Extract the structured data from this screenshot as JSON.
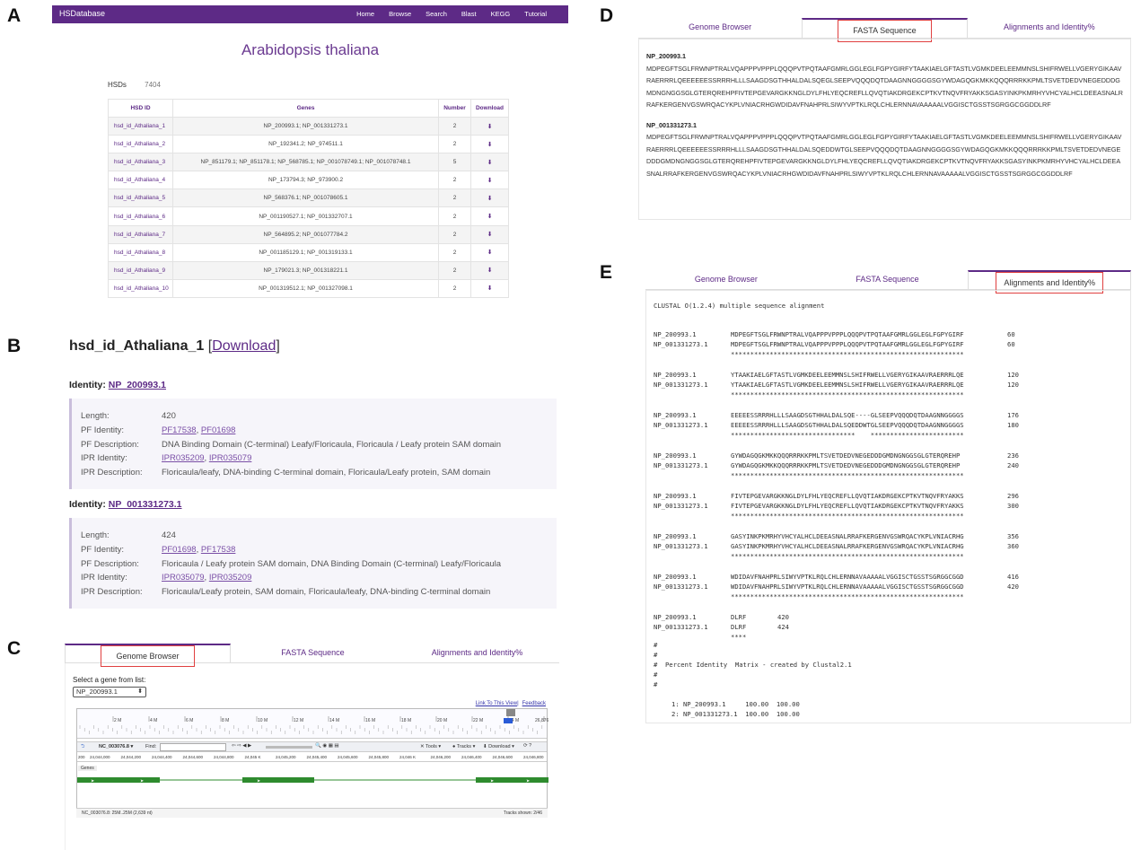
{
  "panel_labels": [
    "A",
    "B",
    "C",
    "D",
    "E"
  ],
  "panelA": {
    "brand": "HSDatabase",
    "nav": [
      "Home",
      "Browse",
      "Search",
      "Blast",
      "KEGG",
      "Tutorial"
    ],
    "species": "Arabidopsis thaliana",
    "hsds_label": "HSDs",
    "hsds_count": "7404",
    "columns": [
      "HSD ID",
      "Genes",
      "Number",
      "Download"
    ],
    "rows": [
      {
        "id": "hsd_id_Athaliana_1",
        "genes": "NP_200993.1; NP_001331273.1",
        "number": "2"
      },
      {
        "id": "hsd_id_Athaliana_2",
        "genes": "NP_192341.2; NP_974511.1",
        "number": "2"
      },
      {
        "id": "hsd_id_Athaliana_3",
        "genes": "NP_851179.1; NP_851178.1; NP_568785.1; NP_001078749.1; NP_001078748.1",
        "number": "5"
      },
      {
        "id": "hsd_id_Athaliana_4",
        "genes": "NP_173794.3; NP_973900.2",
        "number": "2"
      },
      {
        "id": "hsd_id_Athaliana_5",
        "genes": "NP_568376.1; NP_001078605.1",
        "number": "2"
      },
      {
        "id": "hsd_id_Athaliana_6",
        "genes": "NP_001190527.1; NP_001332707.1",
        "number": "2"
      },
      {
        "id": "hsd_id_Athaliana_7",
        "genes": "NP_564895.2; NP_001077784.2",
        "number": "2"
      },
      {
        "id": "hsd_id_Athaliana_8",
        "genes": "NP_001185129.1; NP_001319133.1",
        "number": "2"
      },
      {
        "id": "hsd_id_Athaliana_9",
        "genes": "NP_179021.3; NP_001318221.1",
        "number": "2"
      },
      {
        "id": "hsd_id_Athaliana_10",
        "genes": "NP_001319512.1; NP_001327098.1",
        "number": "2"
      }
    ]
  },
  "panelB": {
    "title": "hsd_id_Athaliana_1",
    "download": "Download",
    "identity_label": "Identity:",
    "entries": [
      {
        "identity": "NP_200993.1",
        "length": "420",
        "pf_identity": [
          "PF17538",
          "PF01698"
        ],
        "pf_description": "DNA Binding Domain (C-terminal) Leafy/Floricaula, Floricaula / Leafy protein SAM domain",
        "ipr_identity": [
          "IPR035209",
          "IPR035079"
        ],
        "ipr_description": "Floricaula/leafy, DNA-binding C-terminal domain, Floricaula/Leafy protein, SAM domain"
      },
      {
        "identity": "NP_001331273.1",
        "length": "424",
        "pf_identity": [
          "PF01698",
          "PF17538"
        ],
        "pf_description": "Floricaula / Leafy protein SAM domain, DNA Binding Domain (C-terminal) Leafy/Floricaula",
        "ipr_identity": [
          "IPR035079",
          "IPR035209"
        ],
        "ipr_description": "Floricaula/Leafy protein, SAM domain, Floricaula/leafy, DNA-binding C-terminal domain"
      }
    ],
    "keys": [
      "Length:",
      "PF Identity:",
      "PF Description:",
      "IPR Identity:",
      "IPR Description:"
    ]
  },
  "tabs": [
    "Genome Browser",
    "FASTA Sequence",
    "Alignments and Identity%"
  ],
  "panelC": {
    "select_label": "Select a gene from list:",
    "selected_gene": "NP_200993.1",
    "links": [
      "Link To This View",
      "Feedback"
    ],
    "ruler_ticks": [
      "2 M",
      "4 M",
      "6 M",
      "8 M",
      "10 M",
      "12 M",
      "14 M",
      "16 M",
      "18 M",
      "20 M",
      "22 M",
      "24 M",
      "26,876,602"
    ],
    "toolbar_chrom": "NC_003076.8",
    "toolbar_find": "Find:",
    "toolbar_tools": "Tools",
    "toolbar_tracks": "Tracks",
    "toolbar_download": "Download",
    "coords": [
      "24,044,000",
      "24,044,200",
      "24,044,400",
      "24,044,600",
      "24,044,800",
      "24,045 K",
      "24,045,200",
      "24,045,400",
      "24,045,600",
      "24,045,800",
      "24,046 K",
      "24,046,200",
      "24,046,400",
      "24,046,600",
      "24,046,800"
    ],
    "coords_right": "200",
    "track_name": "Genes",
    "status_left": "NC_003076.8: 25M..25M (2,639 nt)",
    "status_right": "Tracks shown: 2/46"
  },
  "panelD": {
    "entries": [
      {
        "name": "NP_200993.1",
        "seq": "MDPEGFTSGLFRWNPTRALVQAPPPVPPPLQQQPVTPQTAAFGMRLGGLEGLFGPYGIRFYTAAKIAELGFTASTLVGMKDEELEEMMNSLSHIFRWELLVGERYGIKAAVRAERRRLQEEEEEESSRRRHLLLSAAGDSGTHHALDALSQEGLSEEPVQQQDQTDAAGNNGGGGSGYWDAGQGKMKKQQQRRRKKPMLTSVETDEDVNEGEDDDGMDNGNGGSGLGTERQREHPFIVTEPGEVARGKKNGLDYLFHLYEQCREFLLQVQTIAKDRGEKCPTKVTNQVFRYAKKSGASYINKPKMRHYVHCYALHCLDEEASNALRRAFKERGENVGSWRQACYKPLVNIACRHGWDIDAVFNAHPRLSIWYVPTKLRQLCHLERNNAVAAAAALVGGISCTGSSTSGRGGCGGDDLRF"
      },
      {
        "name": "NP_001331273.1",
        "seq": "MDPEGFTSGLFRWNPTRALVQAPPPVPPPLQQQPVTPQTAAFGMRLGGLEGLFGPYGIRFYTAAKIAELGFTASTLVGMKDEELEEMMNSLSHIFRWELLVGERYGIKAAVRAERRRLQEEEEEESSRRRHLLLSAAGDSGTHHALDALSQEDDWTGLSEEPVQQQDQTDAAGNNGGGGSGYWDAGQGKMKKQQQRRRKKPMLTSVETDEDVNEGEDDDGMDNGNGGSGLGTERQREHPFIVTEPGEVARGKKNGLDYLFHLYEQCREFLLQVQTIAKDRGEKCPTKVTNQVFRYAKKSGASYINKPKMRHYVHCYALHCLDEEASNALRRAFKERGENVGSWRQACYKPLVNIACRHGWDIDAVFNAHPRLSIWYVPTKLRQLCHLERNNAVAAAAALVGGISCTGSSTSGRGGCGGDDLRF"
      }
    ]
  },
  "panelE": {
    "header": "CLUSTAL O(1.2.4) multiple sequence alignment",
    "blocks": [
      {
        "a": "MDPEGFTSGLFRWNPTRALVQAPPPVPPPLQQQPVTPQTAAFGMRLGGLEGLFGPYGIRF",
        "an": "60",
        "b": "MDPEGFTSGLFRWNPTRALVQAPPPVPPPLQQQPVTPQTAAFGMRLGGLEGLFGPYGIRF",
        "bn": "60",
        "c": "************************************************************"
      },
      {
        "a": "YTAAKIAELGFTASTLVGMKDEELEEMMNSLSHIFRWELLVGERYGIKAAVRAERRRLQE",
        "an": "120",
        "b": "YTAAKIAELGFTASTLVGMKDEELEEMMNSLSHIFRWELLVGERYGIKAAVRAERRRLQE",
        "bn": "120",
        "c": "************************************************************"
      },
      {
        "a": "EEEEESSRRRHLLLSAAGDSGTHHALDALSQE----GLSEEPVQQQDQTDAAGNNGGGGS",
        "an": "176",
        "b": "EEEEESSRRRHLLLSAAGDSGTHHALDALSQEDDWTGLSEEPVQQQDQTDAAGNNGGGGS",
        "bn": "180",
        "c": "********************************    ************************"
      },
      {
        "a": "GYWDAGQGKMKKQQQRRRKKPMLTSVETDEDVNEGEDDDGMDNGNGGSGLGTERQREHP",
        "an": "236",
        "b": "GYWDAGQGKMKKQQQRRRKKPMLTSVETDEDVNEGEDDDGMDNGNGGSGLGTERQREHP",
        "bn": "240",
        "c": "************************************************************"
      },
      {
        "a": "FIVTEPGEVARGKKNGLDYLFHLYEQCREFLLQVQTIAKDRGEKCPTKVTNQVFRYAKKS",
        "an": "296",
        "b": "FIVTEPGEVARGKKNGLDYLFHLYEQCREFLLQVQTIAKDRGEKCPTKVTNQVFRYAKKS",
        "bn": "300",
        "c": "************************************************************"
      },
      {
        "a": "GASYINKPKMRHYVHCYALHCLDEEASNALRRAFKERGENVGSWRQACYKPLVNIACRHG",
        "an": "356",
        "b": "GASYINKPKMRHYVHCYALHCLDEEASNALRRAFKERGENVGSWRQACYKPLVNIACRHG",
        "bn": "360",
        "c": "************************************************************"
      },
      {
        "a": "WDIDAVFNAHPRLSIWYVPTKLRQLCHLERNNAVAAAAALVGGISCTGSSTSGRGGCGGD",
        "an": "416",
        "b": "WDIDAVFNAHPRLSIWYVPTKLRQLCHLERNNAVAAAAALVGGISCTGSSTSGRGGCGGD",
        "bn": "420",
        "c": "************************************************************"
      },
      {
        "a": "DLRF",
        "an": "420",
        "b": "DLRF",
        "bn": "424",
        "c": "****"
      }
    ],
    "seq_a": "NP_200993.1",
    "seq_b": "NP_001331273.1",
    "matrix_lines": [
      "#",
      "#",
      "#  Percent Identity  Matrix - created by Clustal2.1",
      "#",
      "#"
    ],
    "matrix_rows": [
      "1: NP_200993.1     100.00  100.00",
      "2: NP_001331273.1  100.00  100.00"
    ]
  },
  "colors": {
    "brand": "#5d2a86",
    "highlight_box": "#e04040",
    "gene_track": "#2e8b2e"
  }
}
